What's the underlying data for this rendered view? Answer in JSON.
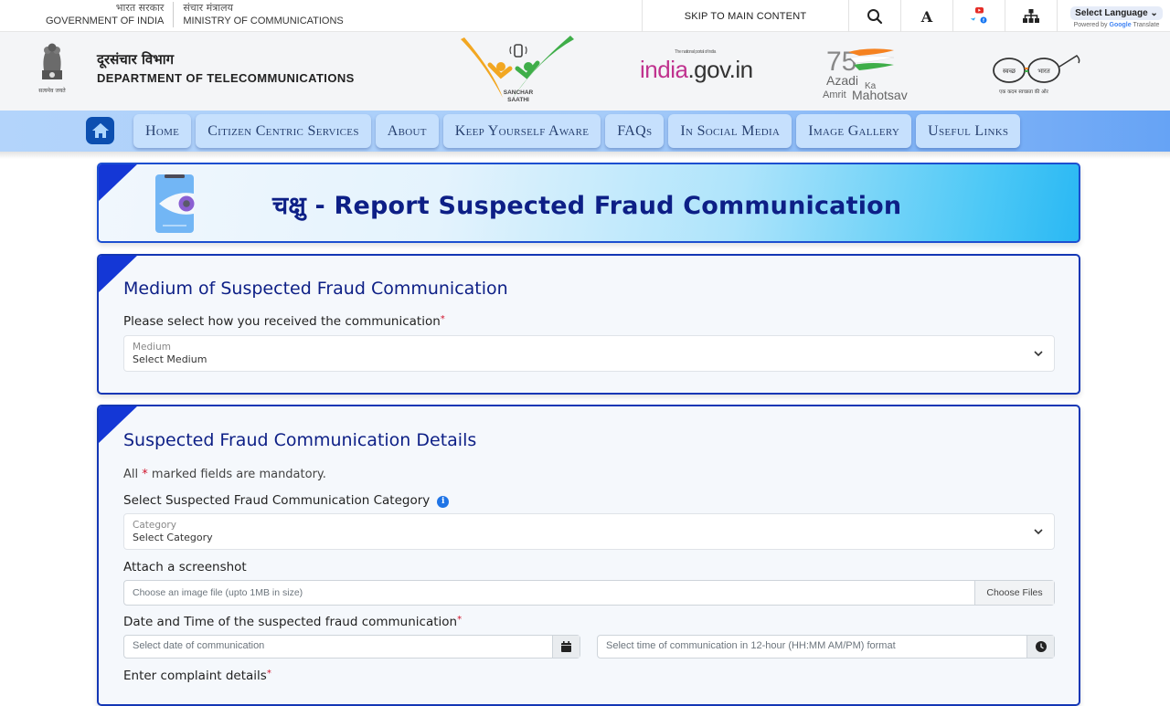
{
  "topbar": {
    "gov_hi": "भारत सरकार",
    "gov_en": "GOVERNMENT OF INDIA",
    "ministry_hi": "संचार मंत्रालय",
    "ministry_en": "MINISTRY OF COMMUNICATIONS",
    "skip_link": "SKIP TO MAIN CONTENT",
    "icons": [
      "search-icon",
      "font-size-icon",
      "social-media-icon",
      "sitemap-icon"
    ],
    "language_select": "Select Language",
    "powered_by": "Powered by",
    "google": "Google",
    "translate": "Translate"
  },
  "header": {
    "dept_hi": "दूरसंचार विभाग",
    "dept_en": "DEPARTMENT OF TELECOMMUNICATIONS",
    "emblem_motto": "सत्यमेव जयते",
    "logos": {
      "sanchar_saathi": "SANCHAR SAATHI",
      "indiagov_tag": "The national portal of india",
      "indiagov_india": "india",
      "indiagov_rest": ".gov.in",
      "azadi_line1": "Azadi",
      "azadi_ka": "Ka",
      "azadi_amrit": "Amrit",
      "azadi_mahotsav": "Mahotsav",
      "azadi_number": "75",
      "swachh_left": "स्वच्छ",
      "swachh_right": "भारत",
      "swachh_tag": "एक कदम स्वच्छता की ओर"
    }
  },
  "nav": {
    "items": [
      {
        "label": "Home"
      },
      {
        "label": "Citizen Centric Services"
      },
      {
        "label": "About"
      },
      {
        "label": "Keep Yourself Aware"
      },
      {
        "label": "FAQs"
      },
      {
        "label": "In Social Media"
      },
      {
        "label": "Image Gallery"
      },
      {
        "label": "Useful Links"
      }
    ]
  },
  "banner": {
    "title_hi": "चक्षु",
    "title_sep": " - ",
    "title_en": "Report Suspected Fraud Communication"
  },
  "medium": {
    "title": "Medium of Suspected Fraud Communication",
    "label": "Please select how you received the communication",
    "required": "*",
    "select_small": "Medium",
    "select_value": "Select Medium"
  },
  "details": {
    "title": "Suspected Fraud Communication Details",
    "note_pre": "All",
    "note_star": "*",
    "note_post": "marked fields are mandatory.",
    "category_label": "Select Suspected Fraud Communication Category",
    "category_small": "Category",
    "category_value": "Select Category",
    "screenshot_label": "Attach a screenshot",
    "screenshot_placeholder": "Choose an image file (upto 1MB in size)",
    "choose_files": "Choose Files",
    "datetime_label": "Date and Time of the suspected fraud communication",
    "date_placeholder": "Select date of communication",
    "time_placeholder": "Select time of communication in 12-hour (HH:MM AM/PM) format",
    "complaint_label": "Enter complaint details",
    "required": "*"
  },
  "colors": {
    "brand_navy": "#0d1f86",
    "card_border": "#1437b5",
    "nav_bg": "#b3d4fb",
    "nav_item": "#c6e0fd",
    "required": "#d0142c",
    "info": "#1f74e6"
  }
}
